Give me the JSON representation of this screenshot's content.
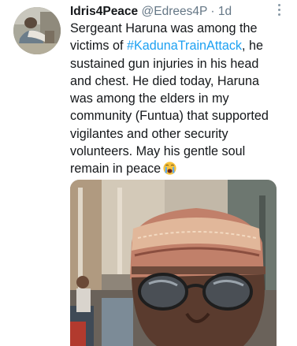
{
  "user": {
    "display_name": "Idris4Peace",
    "handle": "@Edrees4P",
    "separator": "·",
    "timestamp": "1d"
  },
  "tweet": {
    "lines": [
      "Sergeant Haruna was among the",
      "victims of ",
      ", he",
      "sustained gun injuries in his head",
      "and chest. He died today, Haruna",
      "was among the elders in my",
      "community (Funtua) that supported",
      "vigilantes and other security",
      "volunteers. May his gentle soul",
      "remain in peace"
    ],
    "hashtag": "#KadunaTrainAttack",
    "emoji": "crying-face-emoji"
  },
  "icons": {
    "more": "more-vertical-icon"
  },
  "colors": {
    "text": "#14171a",
    "secondary": "#657786",
    "link": "#1da1f2",
    "background": "#ffffff"
  }
}
